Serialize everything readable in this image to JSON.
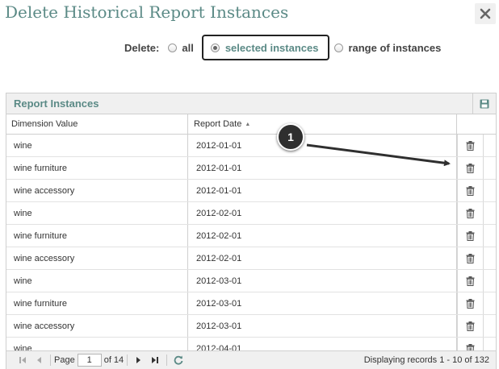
{
  "dialog": {
    "title": "Delete Historical Report Instances",
    "close_label": "✕"
  },
  "delete_options": {
    "label": "Delete:",
    "options": [
      {
        "label": "all",
        "checked": false
      },
      {
        "label": "selected instances",
        "checked": true
      },
      {
        "label": "range of instances",
        "checked": false
      }
    ]
  },
  "grid": {
    "title": "Report Instances",
    "columns": [
      "Dimension Value",
      "Report Date"
    ],
    "rows": [
      {
        "dimension": "wine",
        "date": "2012-01-01"
      },
      {
        "dimension": "wine furniture",
        "date": "2012-01-01"
      },
      {
        "dimension": "wine accessory",
        "date": "2012-01-01"
      },
      {
        "dimension": "wine",
        "date": "2012-02-01"
      },
      {
        "dimension": "wine furniture",
        "date": "2012-02-01"
      },
      {
        "dimension": "wine accessory",
        "date": "2012-02-01"
      },
      {
        "dimension": "wine",
        "date": "2012-03-01"
      },
      {
        "dimension": "wine furniture",
        "date": "2012-03-01"
      },
      {
        "dimension": "wine accessory",
        "date": "2012-03-01"
      },
      {
        "dimension": "wine",
        "date": "2012-04-01"
      }
    ]
  },
  "pagination": {
    "page_label": "Page",
    "current_page": "1",
    "of_label": "of 14",
    "display_info": "Displaying records 1 - 10 of 132"
  },
  "callout": {
    "number": "1"
  },
  "icons": {
    "close": "close-icon",
    "save": "save-icon",
    "delete": "trash-icon",
    "first": "first-page-icon",
    "prev": "prev-page-icon",
    "next": "next-page-icon",
    "last": "last-page-icon",
    "refresh": "refresh-icon"
  },
  "colors": {
    "accent": "#5b8a86",
    "callout": "#2f2f2f"
  }
}
